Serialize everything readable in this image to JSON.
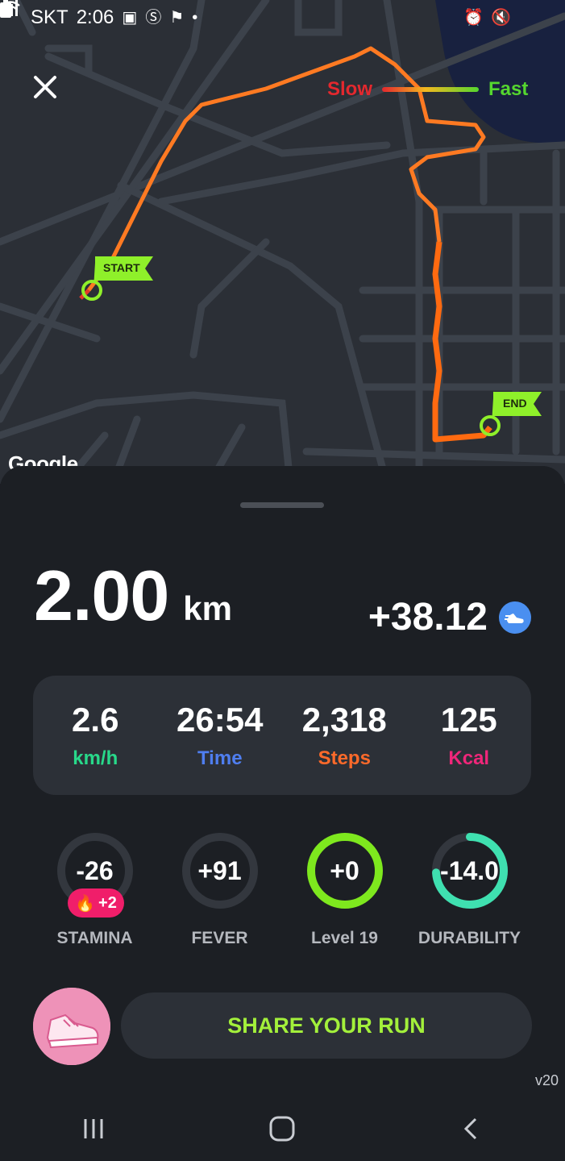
{
  "status_bar": {
    "carrier": "SKT",
    "time": "2:06",
    "icons": [
      "image-icon",
      "samsung-pay-icon",
      "flag-icon",
      "dot-icon",
      "alarm-icon",
      "mute-icon",
      "wifi-icon",
      "signal-icon",
      "battery-icon"
    ]
  },
  "map": {
    "legend": {
      "slow": "Slow",
      "fast": "Fast"
    },
    "start_flag": "START",
    "end_flag": "END",
    "attribution": "Google"
  },
  "summary": {
    "distance_value": "2.00",
    "distance_unit": "km",
    "earned": "+38.12"
  },
  "stats": [
    {
      "value": "2.6",
      "label": "km/h",
      "color": "#28d98a"
    },
    {
      "value": "26:54",
      "label": "Time",
      "color": "#4f7ef0"
    },
    {
      "value": "2,318",
      "label": "Steps",
      "color": "#ff6a2a"
    },
    {
      "value": "125",
      "label": "Kcal",
      "color": "#f0267a"
    }
  ],
  "rings": [
    {
      "value": "-26",
      "label": "STAMINA",
      "badge": "+2",
      "fill": 0
    },
    {
      "value": "+91",
      "label": "FEVER",
      "fill": 0
    },
    {
      "value": "+0",
      "label": "Level 19",
      "fill": 1.0
    },
    {
      "value": "-14.0",
      "label": "DURABILITY",
      "fill": 0.74
    }
  ],
  "share_label": "SHARE YOUR RUN",
  "version": "v20",
  "colors": {
    "accent_green": "#a3f03b",
    "ring_green": "#7ee81e",
    "ring_teal": "#3fe0b0"
  }
}
